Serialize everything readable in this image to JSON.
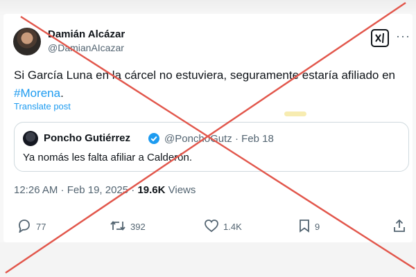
{
  "post": {
    "author_name": "Damián Alcázar",
    "author_handle": "@DamianAIcazar",
    "text_main": "Si García Luna en la cárcel no estuviera, seguramente estaría afiliado en",
    "hashtag": "#Morena",
    "text_end": ".",
    "translate_label": "Translate post",
    "more_label": "···",
    "timestamp": "12:26 AM · Feb 19, 2025 · ",
    "views_count": "19.6K",
    "views_label": " Views"
  },
  "quote": {
    "author_name": "Poncho Gutiérrez",
    "author_handle": "@PonchoGutz · Feb 18",
    "text": "Ya nomás les falta afiliar a Calderón."
  },
  "actions": {
    "replies": "77",
    "reposts": "392",
    "likes": "1.4K",
    "bookmarks": "9"
  },
  "colors": {
    "accent": "#1d9bf0",
    "overlay_cross": "#e2574c"
  },
  "icons": [
    "grok-icon",
    "more-icon",
    "verified-badge-icon",
    "reply-icon",
    "repost-icon",
    "like-icon",
    "bookmark-icon",
    "share-icon"
  ]
}
